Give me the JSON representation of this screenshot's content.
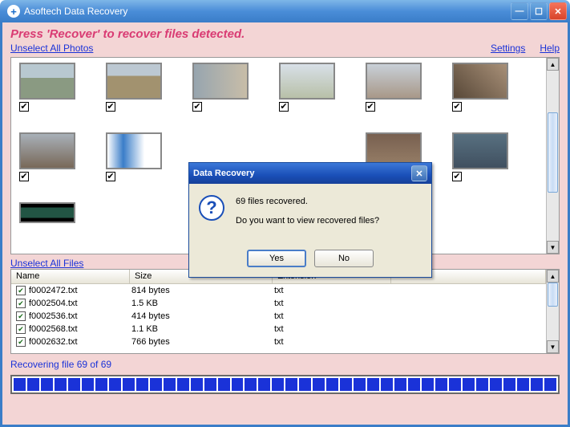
{
  "titlebar": {
    "title": "Asoftech Data Recovery"
  },
  "instruction": "Press 'Recover' to recover files detected.",
  "links": {
    "unselect_photos": "Unselect All Photos",
    "unselect_files": "Unselect All Files",
    "settings": "Settings",
    "help": "Help"
  },
  "file_table": {
    "columns": {
      "name": "Name",
      "size": "Size",
      "extension": "Extension"
    },
    "rows": [
      {
        "name": "f0002472.txt",
        "size": "814 bytes",
        "ext": "txt"
      },
      {
        "name": "f0002504.txt",
        "size": "1.5 KB",
        "ext": "txt"
      },
      {
        "name": "f0002536.txt",
        "size": "414 bytes",
        "ext": "txt"
      },
      {
        "name": "f0002568.txt",
        "size": "1.1 KB",
        "ext": "txt"
      },
      {
        "name": "f0002632.txt",
        "size": "766 bytes",
        "ext": "txt"
      }
    ]
  },
  "status": "Recovering file 69 of 69",
  "dialog": {
    "title": "Data Recovery",
    "line1": "69 files recovered.",
    "line2": "Do you want to view recovered files?",
    "yes": "Yes",
    "no": "No"
  },
  "checkmark": "✔",
  "x": "✕"
}
